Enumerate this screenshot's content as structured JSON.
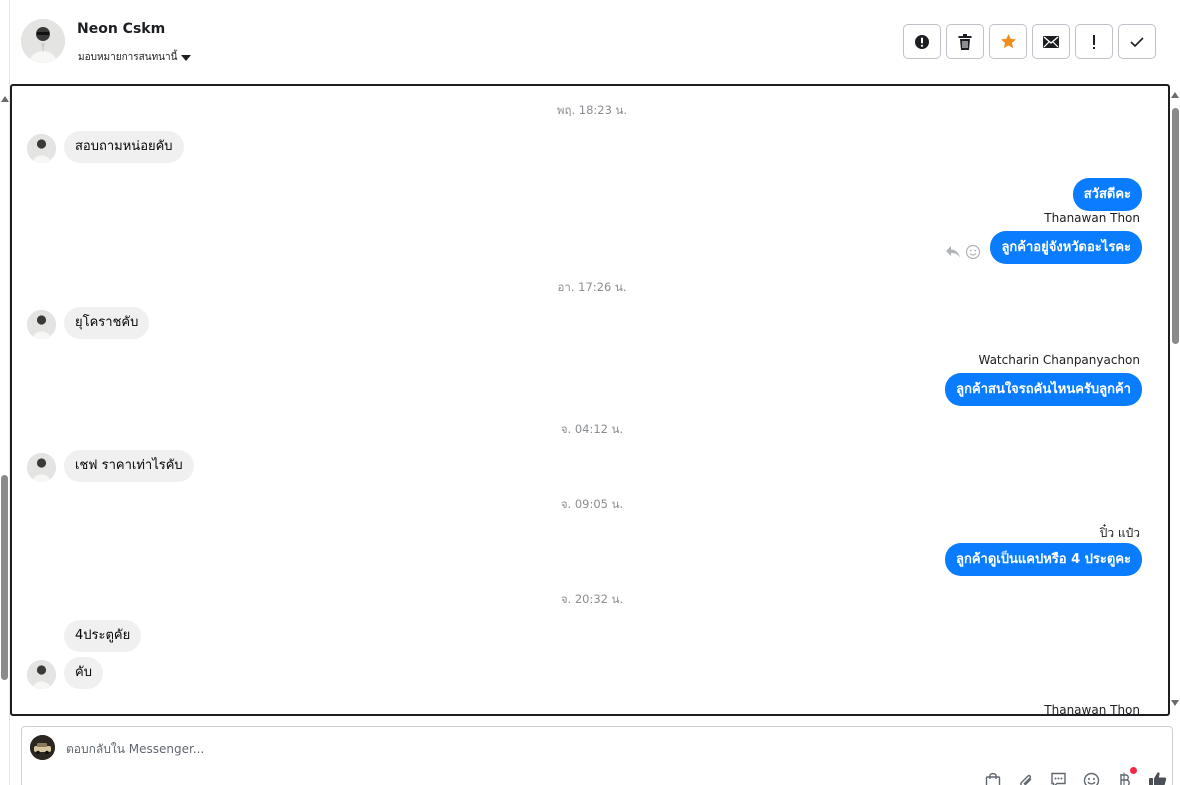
{
  "header": {
    "name": "Neon Cskm",
    "assign_label": "มอบหมายการสนทนานี้",
    "actions": [
      {
        "name": "alert-circle-icon",
        "title": "alert"
      },
      {
        "name": "trash-icon",
        "title": "delete"
      },
      {
        "name": "star-icon",
        "title": "star"
      },
      {
        "name": "envelope-icon",
        "title": "mail"
      },
      {
        "name": "exclamation-icon",
        "title": "important"
      },
      {
        "name": "check-icon",
        "title": "done"
      }
    ]
  },
  "colors": {
    "outgoing_bubble": "#0a7cff",
    "incoming_bubble": "#f0f0f0",
    "star": "#f28c18",
    "notification_dot": "#f02849"
  },
  "conversation": {
    "timestamps": [
      "พฤ. 18:23 น.",
      "อา. 17:26 น.",
      "จ. 04:12 น.",
      "จ. 09:05 น.",
      "จ. 20:32 น."
    ],
    "messages": [
      {
        "direction": "in",
        "text": "สอบถามหน่อยคับ"
      },
      {
        "direction": "out",
        "text": "สวัสดีคะ"
      },
      {
        "direction": "out",
        "sender": "Thanawan Thon",
        "text": "ลูกค้าอยู่จังหวัดอะไรคะ"
      },
      {
        "direction": "in",
        "text": "ยุโคราชคับ"
      },
      {
        "direction": "out",
        "sender": "Watcharin Chanpanyachon",
        "text": "ลูกค้าสนใจรถคันไหนครับลูกค้า"
      },
      {
        "direction": "in",
        "text": "เชฟ ราคาเท่าไรคับ"
      },
      {
        "direction": "out",
        "sender": "ปิ๋ว แป๋ว",
        "text": "ลูกค้าดูเป็นแคปหรือ 4 ประตูคะ"
      },
      {
        "direction": "in",
        "text": "4ประตูคัย"
      },
      {
        "direction": "in",
        "text": "คับ"
      }
    ],
    "trailing_sender": "Thanawan Thon"
  },
  "composer": {
    "placeholder": "ตอบกลับใน Messenger...",
    "tools": [
      "shopping-bag-icon",
      "paperclip-icon",
      "saved-reply-icon",
      "emoji-icon",
      "baht-payment-icon",
      "thumbs-up-icon"
    ]
  }
}
